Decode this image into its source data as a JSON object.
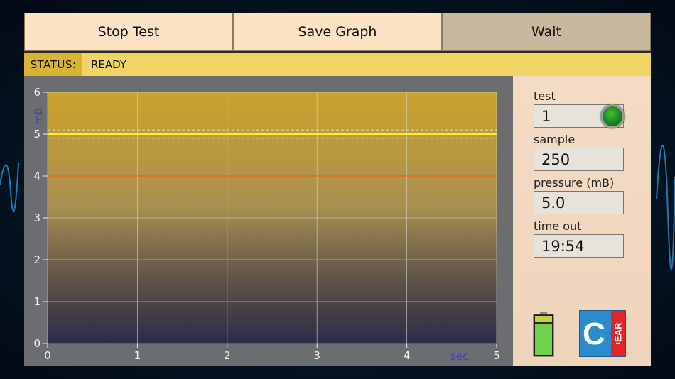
{
  "toolbar": {
    "stop_label": "Stop Test",
    "save_label": "Save Graph",
    "wait_label": "Wait"
  },
  "status": {
    "label": "STATUS:",
    "value": "READY"
  },
  "side": {
    "test_label": "test",
    "test_value": "1",
    "sample_label": "sample",
    "sample_value": "250",
    "pressure_label": "pressure (mB)",
    "pressure_value": "5.0",
    "timeout_label": "time out",
    "timeout_value": "19:54",
    "led_status_color": "#1f9a25",
    "battery_level": 0.8,
    "logo_letter": "C",
    "logo_text": "EAR",
    "logo_superscript": "i"
  },
  "chart_data": {
    "type": "line",
    "xlabel": "sec.",
    "ylabel": "mB",
    "xlim": [
      0,
      5
    ],
    "ylim": [
      0,
      6
    ],
    "x_ticks": [
      "0",
      "1",
      "2",
      "3",
      "4",
      "5"
    ],
    "y_ticks": [
      "0",
      "1",
      "2",
      "3",
      "4",
      "5",
      "6"
    ],
    "grid": true,
    "series": [
      {
        "color": "#f4f02a",
        "x": [
          0,
          5
        ],
        "y": [
          5.0,
          5.0
        ]
      },
      {
        "color": "#e07020",
        "x": [
          0,
          5
        ],
        "y": [
          4.0,
          4.0
        ]
      }
    ],
    "reference_band": [
      4.9,
      5.1
    ]
  }
}
